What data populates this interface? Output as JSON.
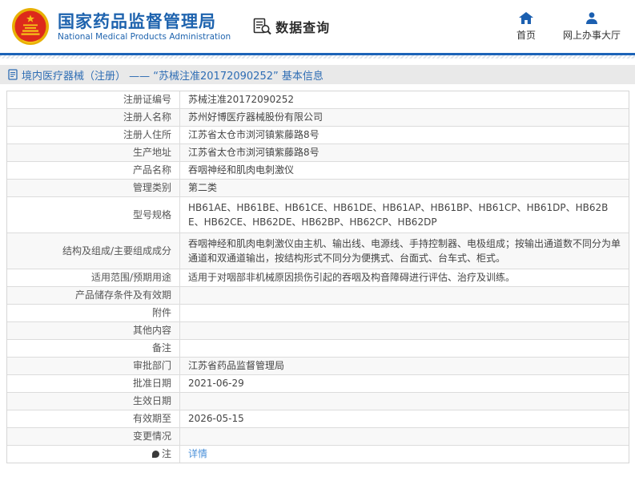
{
  "header": {
    "brand": {
      "title": "国家药品监督管理局",
      "subtitle": "National Medical Products Administration"
    },
    "section_label": "数据查询",
    "nav": [
      {
        "label": "首页",
        "icon": "home-icon"
      },
      {
        "label": "网上办事大厅",
        "icon": "user-icon"
      }
    ]
  },
  "page_title": {
    "text": "境内医疗器械（注册） —— “苏械注准20172090252” 基本信息"
  },
  "table": {
    "rows": [
      {
        "label": "注册证编号",
        "value": "苏械注准20172090252"
      },
      {
        "label": "注册人名称",
        "value": "苏州好博医疗器械股份有限公司"
      },
      {
        "label": "注册人住所",
        "value": "江苏省太仓市浏河镇紫藤路8号"
      },
      {
        "label": "生产地址",
        "value": "江苏省太仓市浏河镇紫藤路8号"
      },
      {
        "label": "产品名称",
        "value": "吞咽神经和肌肉电刺激仪"
      },
      {
        "label": "管理类别",
        "value": "第二类"
      },
      {
        "label": "型号规格",
        "value": "HB61AE、HB61BE、HB61CE、HB61DE、HB61AP、HB61BP、HB61CP、HB61DP、HB62BE、HB62CE、HB62DE、HB62BP、HB62CP、HB62DP"
      },
      {
        "label": "结构及组成/主要组成成分",
        "value": "吞咽神经和肌肉电刺激仪由主机、输出线、电源线、手持控制器、电极组成；按输出通道数不同分为单通道和双通道输出，按结构形式不同分为便携式、台面式、台车式、柜式。"
      },
      {
        "label": "适用范围/预期用途",
        "value": "适用于对咽部非机械原因损伤引起的吞咽及构音障碍进行评估、治疗及训练。"
      },
      {
        "label": "产品储存条件及有效期",
        "value": ""
      },
      {
        "label": "附件",
        "value": ""
      },
      {
        "label": "其他内容",
        "value": ""
      },
      {
        "label": "备注",
        "value": ""
      },
      {
        "label": "审批部门",
        "value": "江苏省药品监督管理局"
      },
      {
        "label": "批准日期",
        "value": "2021-06-29"
      },
      {
        "label": "生效日期",
        "value": ""
      },
      {
        "label": "有效期至",
        "value": "2026-05-15"
      },
      {
        "label": "变更情况",
        "value": ""
      },
      {
        "label": "注",
        "label_icon": "note-icon",
        "value": "详情",
        "value_type": "link"
      }
    ]
  },
  "colors": {
    "brand_blue": "#1e63ae",
    "header_line_blue": "#1c63b8",
    "title_blue": "#2e6db4",
    "link_blue": "#4a90d9",
    "emblem_red": "#dd2a1b",
    "emblem_gold": "#e8b004",
    "nav_icon_blue": "#1b5fb0"
  }
}
